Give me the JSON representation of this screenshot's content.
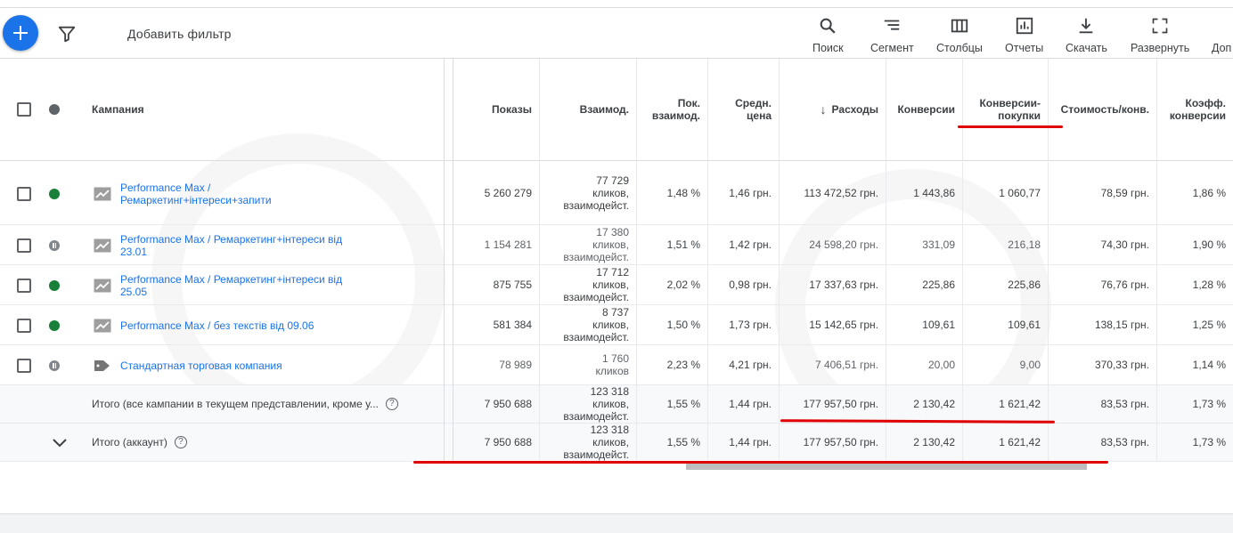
{
  "toolbar": {
    "add_filter_label": "Добавить фильтр",
    "tools": [
      {
        "icon": "search-icon",
        "label": "Поиск"
      },
      {
        "icon": "segment-icon",
        "label": "Сегмент"
      },
      {
        "icon": "columns-icon",
        "label": "Столбцы"
      },
      {
        "icon": "reports-icon",
        "label": "Отчеты"
      },
      {
        "icon": "download-icon",
        "label": "Скачать"
      },
      {
        "icon": "expand-icon",
        "label": "Развернуть"
      },
      {
        "icon": "more-icon",
        "label": "Доп"
      }
    ]
  },
  "columns": {
    "campaign": "Кампания",
    "impressions": "Показы",
    "interactions": "Взаимод.",
    "interaction_rate": "Пок.\nвзаимод.",
    "avg_cost": "Средн.\nцена",
    "cost": "Расходы",
    "conversions": "Конверсии",
    "purchase_conversions": "Конверсии-\nпокупки",
    "cost_per_conv": "Стоимость/конв.",
    "conv_rate": "Коэфф.\nконверсии"
  },
  "campaigns": [
    {
      "status": "enabled",
      "type": "performance-max",
      "name": "Performance Max /\nРемаркетинг+інтереси+запити",
      "impressions": "5 260 279",
      "interactions": "77 729\nкликов,\nвзаимодейст.",
      "interaction_rate": "1,48 %",
      "avg_cost": "1,46 грн.",
      "cost": "113 472,52 грн.",
      "conversions": "1 443,86",
      "purchase_conversions": "1 060,77",
      "cost_per_conv": "78,59 грн.",
      "conv_rate": "1,86 %"
    },
    {
      "status": "paused",
      "type": "performance-max",
      "name": "Performance Max / Ремаркетинг+інтереси від\n23.01",
      "impressions": "1 154 281",
      "interactions": "17 380\nкликов,\nвзаимодейст.",
      "interaction_rate": "1,51 %",
      "avg_cost": "1,42 грн.",
      "cost": "24 598,20 грн.",
      "conversions": "331,09",
      "purchase_conversions": "216,18",
      "cost_per_conv": "74,30 грн.",
      "conv_rate": "1,90 %"
    },
    {
      "status": "enabled",
      "type": "performance-max",
      "name": "Performance Max / Ремаркетинг+інтереси від\n25.05",
      "impressions": "875 755",
      "interactions": "17 712\nкликов,\nвзаимодейст.",
      "interaction_rate": "2,02 %",
      "avg_cost": "0,98 грн.",
      "cost": "17 337,63 грн.",
      "conversions": "225,86",
      "purchase_conversions": "225,86",
      "cost_per_conv": "76,76 грн.",
      "conv_rate": "1,28 %"
    },
    {
      "status": "enabled",
      "type": "performance-max",
      "name": "Performance Max / без текстів від 09.06",
      "impressions": "581 384",
      "interactions": "8 737\nкликов,\nвзаимодейст.",
      "interaction_rate": "1,50 %",
      "avg_cost": "1,73 грн.",
      "cost": "15 142,65 грн.",
      "conversions": "109,61",
      "purchase_conversions": "109,61",
      "cost_per_conv": "138,15 грн.",
      "conv_rate": "1,25 %"
    },
    {
      "status": "paused",
      "type": "shopping",
      "name": "Стандартная торговая компания",
      "impressions": "78 989",
      "interactions": "1 760\nкликов",
      "interaction_rate": "2,23 %",
      "avg_cost": "4,21 грн.",
      "cost": "7 406,51 грн.",
      "conversions": "20,00",
      "purchase_conversions": "9,00",
      "cost_per_conv": "370,33 грн.",
      "conv_rate": "1,14 %"
    }
  ],
  "totals": [
    {
      "label": "Итого (все кампании в текущем представлении, кроме у...",
      "impressions": "7 950 688",
      "interactions": "123 318\nкликов,\nвзаимодейст.",
      "interaction_rate": "1,55 %",
      "avg_cost": "1,44 грн.",
      "cost": "177 957,50 грн.",
      "conversions": "2 130,42",
      "purchase_conversions": "1 621,42",
      "cost_per_conv": "83,53 грн.",
      "conv_rate": "1,73 %"
    },
    {
      "label": "Итого (аккаунт)",
      "impressions": "7 950 688",
      "interactions": "123 318\nкликов,\nвзаимодейст.",
      "interaction_rate": "1,55 %",
      "avg_cost": "1,44 грн.",
      "cost": "177 957,50 грн.",
      "conversions": "2 130,42",
      "purchase_conversions": "1 621,42",
      "cost_per_conv": "83,53 грн.",
      "conv_rate": "1,73 %"
    }
  ],
  "colors": {
    "accent": "#1a73e8",
    "enabled": "#188038",
    "annotation": "#e00000"
  }
}
